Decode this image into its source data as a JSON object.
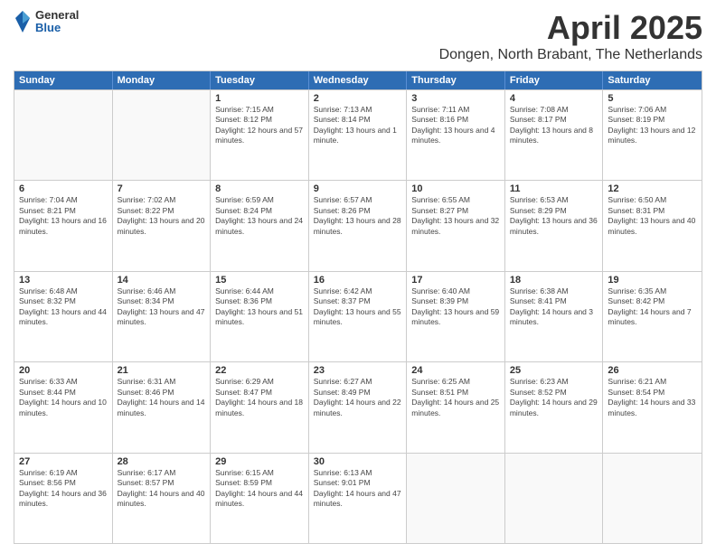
{
  "header": {
    "logo": {
      "general": "General",
      "blue": "Blue"
    },
    "title": "April 2025",
    "subtitle": "Dongen, North Brabant, The Netherlands"
  },
  "weekdays": [
    "Sunday",
    "Monday",
    "Tuesday",
    "Wednesday",
    "Thursday",
    "Friday",
    "Saturday"
  ],
  "rows": [
    [
      {
        "day": "",
        "empty": true
      },
      {
        "day": "",
        "empty": true
      },
      {
        "day": "1",
        "sunrise": "Sunrise: 7:15 AM",
        "sunset": "Sunset: 8:12 PM",
        "daylight": "Daylight: 12 hours and 57 minutes."
      },
      {
        "day": "2",
        "sunrise": "Sunrise: 7:13 AM",
        "sunset": "Sunset: 8:14 PM",
        "daylight": "Daylight: 13 hours and 1 minute."
      },
      {
        "day": "3",
        "sunrise": "Sunrise: 7:11 AM",
        "sunset": "Sunset: 8:16 PM",
        "daylight": "Daylight: 13 hours and 4 minutes."
      },
      {
        "day": "4",
        "sunrise": "Sunrise: 7:08 AM",
        "sunset": "Sunset: 8:17 PM",
        "daylight": "Daylight: 13 hours and 8 minutes."
      },
      {
        "day": "5",
        "sunrise": "Sunrise: 7:06 AM",
        "sunset": "Sunset: 8:19 PM",
        "daylight": "Daylight: 13 hours and 12 minutes."
      }
    ],
    [
      {
        "day": "6",
        "sunrise": "Sunrise: 7:04 AM",
        "sunset": "Sunset: 8:21 PM",
        "daylight": "Daylight: 13 hours and 16 minutes."
      },
      {
        "day": "7",
        "sunrise": "Sunrise: 7:02 AM",
        "sunset": "Sunset: 8:22 PM",
        "daylight": "Daylight: 13 hours and 20 minutes."
      },
      {
        "day": "8",
        "sunrise": "Sunrise: 6:59 AM",
        "sunset": "Sunset: 8:24 PM",
        "daylight": "Daylight: 13 hours and 24 minutes."
      },
      {
        "day": "9",
        "sunrise": "Sunrise: 6:57 AM",
        "sunset": "Sunset: 8:26 PM",
        "daylight": "Daylight: 13 hours and 28 minutes."
      },
      {
        "day": "10",
        "sunrise": "Sunrise: 6:55 AM",
        "sunset": "Sunset: 8:27 PM",
        "daylight": "Daylight: 13 hours and 32 minutes."
      },
      {
        "day": "11",
        "sunrise": "Sunrise: 6:53 AM",
        "sunset": "Sunset: 8:29 PM",
        "daylight": "Daylight: 13 hours and 36 minutes."
      },
      {
        "day": "12",
        "sunrise": "Sunrise: 6:50 AM",
        "sunset": "Sunset: 8:31 PM",
        "daylight": "Daylight: 13 hours and 40 minutes."
      }
    ],
    [
      {
        "day": "13",
        "sunrise": "Sunrise: 6:48 AM",
        "sunset": "Sunset: 8:32 PM",
        "daylight": "Daylight: 13 hours and 44 minutes."
      },
      {
        "day": "14",
        "sunrise": "Sunrise: 6:46 AM",
        "sunset": "Sunset: 8:34 PM",
        "daylight": "Daylight: 13 hours and 47 minutes."
      },
      {
        "day": "15",
        "sunrise": "Sunrise: 6:44 AM",
        "sunset": "Sunset: 8:36 PM",
        "daylight": "Daylight: 13 hours and 51 minutes."
      },
      {
        "day": "16",
        "sunrise": "Sunrise: 6:42 AM",
        "sunset": "Sunset: 8:37 PM",
        "daylight": "Daylight: 13 hours and 55 minutes."
      },
      {
        "day": "17",
        "sunrise": "Sunrise: 6:40 AM",
        "sunset": "Sunset: 8:39 PM",
        "daylight": "Daylight: 13 hours and 59 minutes."
      },
      {
        "day": "18",
        "sunrise": "Sunrise: 6:38 AM",
        "sunset": "Sunset: 8:41 PM",
        "daylight": "Daylight: 14 hours and 3 minutes."
      },
      {
        "day": "19",
        "sunrise": "Sunrise: 6:35 AM",
        "sunset": "Sunset: 8:42 PM",
        "daylight": "Daylight: 14 hours and 7 minutes."
      }
    ],
    [
      {
        "day": "20",
        "sunrise": "Sunrise: 6:33 AM",
        "sunset": "Sunset: 8:44 PM",
        "daylight": "Daylight: 14 hours and 10 minutes."
      },
      {
        "day": "21",
        "sunrise": "Sunrise: 6:31 AM",
        "sunset": "Sunset: 8:46 PM",
        "daylight": "Daylight: 14 hours and 14 minutes."
      },
      {
        "day": "22",
        "sunrise": "Sunrise: 6:29 AM",
        "sunset": "Sunset: 8:47 PM",
        "daylight": "Daylight: 14 hours and 18 minutes."
      },
      {
        "day": "23",
        "sunrise": "Sunrise: 6:27 AM",
        "sunset": "Sunset: 8:49 PM",
        "daylight": "Daylight: 14 hours and 22 minutes."
      },
      {
        "day": "24",
        "sunrise": "Sunrise: 6:25 AM",
        "sunset": "Sunset: 8:51 PM",
        "daylight": "Daylight: 14 hours and 25 minutes."
      },
      {
        "day": "25",
        "sunrise": "Sunrise: 6:23 AM",
        "sunset": "Sunset: 8:52 PM",
        "daylight": "Daylight: 14 hours and 29 minutes."
      },
      {
        "day": "26",
        "sunrise": "Sunrise: 6:21 AM",
        "sunset": "Sunset: 8:54 PM",
        "daylight": "Daylight: 14 hours and 33 minutes."
      }
    ],
    [
      {
        "day": "27",
        "sunrise": "Sunrise: 6:19 AM",
        "sunset": "Sunset: 8:56 PM",
        "daylight": "Daylight: 14 hours and 36 minutes."
      },
      {
        "day": "28",
        "sunrise": "Sunrise: 6:17 AM",
        "sunset": "Sunset: 8:57 PM",
        "daylight": "Daylight: 14 hours and 40 minutes."
      },
      {
        "day": "29",
        "sunrise": "Sunrise: 6:15 AM",
        "sunset": "Sunset: 8:59 PM",
        "daylight": "Daylight: 14 hours and 44 minutes."
      },
      {
        "day": "30",
        "sunrise": "Sunrise: 6:13 AM",
        "sunset": "Sunset: 9:01 PM",
        "daylight": "Daylight: 14 hours and 47 minutes."
      },
      {
        "day": "",
        "empty": true
      },
      {
        "day": "",
        "empty": true
      },
      {
        "day": "",
        "empty": true
      }
    ]
  ]
}
